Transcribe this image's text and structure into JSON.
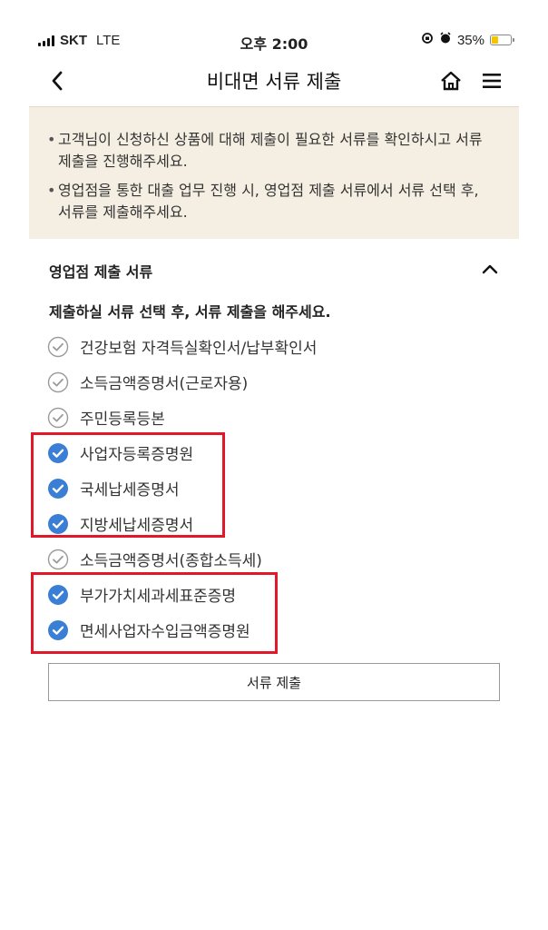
{
  "status_bar": {
    "carrier": "SKT",
    "network": "LTE",
    "time": "오후 2:00",
    "battery_percent": "35%",
    "battery_level": 0.35,
    "battery_color": "#f5c400"
  },
  "header": {
    "title": "비대면 서류 제출",
    "back_icon": "chevron-left-icon",
    "home_icon": "home-icon",
    "menu_icon": "hamburger-menu-icon"
  },
  "notice": {
    "items": [
      "고객님이 신청하신 상품에 대해 제출이 필요한 서류를 확인하시고 서류 제출을 진행해주세요.",
      "영업점을 통한 대출 업무 진행 시, 영업점 제출 서류에서 서류 선택 후, 서류를 제출해주세요."
    ]
  },
  "section": {
    "title": "영업점 제출 서류",
    "collapse_icon": "chevron-up-icon",
    "instruction": "제출하실 서류 선택 후, 서류 제출을 해주세요.",
    "documents": [
      {
        "label": "건강보험 자격득실확인서/납부확인서",
        "checked": false
      },
      {
        "label": "소득금액증명서(근로자용)",
        "checked": false
      },
      {
        "label": "주민등록등본",
        "checked": false
      },
      {
        "label": "사업자등록증명원",
        "checked": true
      },
      {
        "label": "국세납세증명서",
        "checked": true
      },
      {
        "label": "지방세납세증명서",
        "checked": true
      },
      {
        "label": "소득금액증명서(종합소득세)",
        "checked": false
      },
      {
        "label": "부가가치세과세표준증명",
        "checked": true
      },
      {
        "label": "면세사업자수입금액증명원",
        "checked": true
      }
    ]
  },
  "submit_button": {
    "label": "서류 제출"
  },
  "colors": {
    "check_active": "#3a7fd5",
    "check_inactive": "#9a9a9a",
    "highlight": "#e0182a",
    "notice_bg": "#f5efe3"
  }
}
